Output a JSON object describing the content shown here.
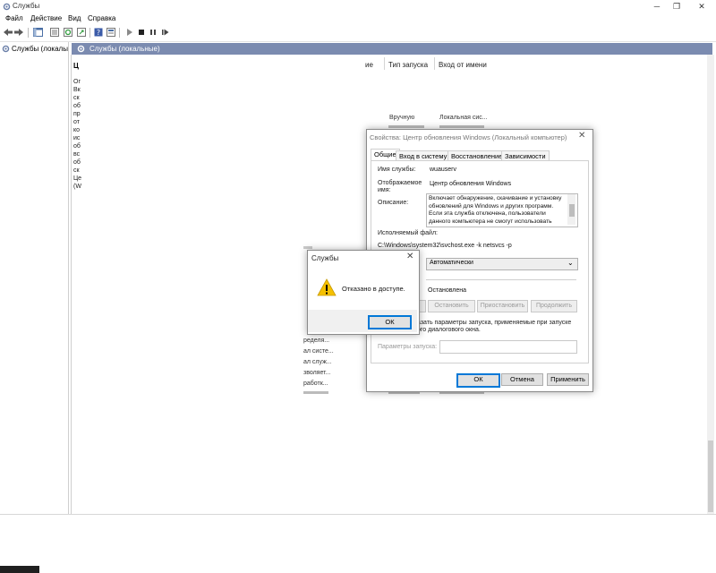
{
  "window": {
    "title": "Службы",
    "minimize": "─",
    "maximize": "❐",
    "close": "✕"
  },
  "menu": [
    "Файл",
    "Действие",
    "Вид",
    "Справка"
  ],
  "tree": {
    "item": "Службы (локалы"
  },
  "panel": {
    "title": "Службы (локальные)"
  },
  "left_pane": {
    "heading": "Ц",
    "lines": [
      "Ог",
      "Вк",
      "ск",
      "об",
      "пр",
      "от",
      "ко",
      "ис",
      "об",
      "вс",
      "об",
      "ск",
      "Це",
      "(W"
    ]
  },
  "columns": {
    "col1": "ие",
    "col2": "Тип запуска",
    "col3": "Вход от имени"
  },
  "rows_visible": [
    {
      "start": "Вручную",
      "logon": "Локальная сис..."
    }
  ],
  "desc_fragments": [
    "ределя...",
    "ал систе...",
    "ал служ...",
    "зволяет...",
    "работк..."
  ],
  "props": {
    "title": "Свойства: Центр обновления Windows (Локальный компьютер)",
    "close": "✕",
    "tabs": [
      "Общие",
      "Вход в систему",
      "Восстановление",
      "Зависимости"
    ],
    "service_name_label": "Имя службы:",
    "service_name": "wuauserv",
    "display_name_label_1": "Отображаемое",
    "display_name_label_2": "имя:",
    "display_name": "Центр обновления Windows",
    "description_label": "Описание:",
    "description_lines": [
      "Включает обнаружение, скачивание и установку",
      "обновлений для Windows и других программ.",
      "Если эта служба отключена, пользователи",
      "данного компьютера не смогут использовать"
    ],
    "exe_label": "Исполняемый файл:",
    "exe_path": "C:\\Windows\\system32\\svchost.exe -k netsvcs -p",
    "startup_type": "Автоматически",
    "status_value": "Остановлена",
    "buttons": [
      "Остановить",
      "Приостановить",
      "Продолжить"
    ],
    "hint_line_1": "азать параметры запуска, применяемые при запуске",
    "hint_line_2": "ого диалогового окна.",
    "params_label": "Параметры запуска:",
    "ok": "ОК",
    "cancel": "Отмена",
    "apply": "Применить"
  },
  "error_dialog": {
    "title": "Службы",
    "close": "✕",
    "message": "Отказано в доступе.",
    "ok": "ОК"
  },
  "colors": {
    "panel_header": "#7b8bb0",
    "focus_border": "#0078d7",
    "warning": "#f5c000"
  }
}
